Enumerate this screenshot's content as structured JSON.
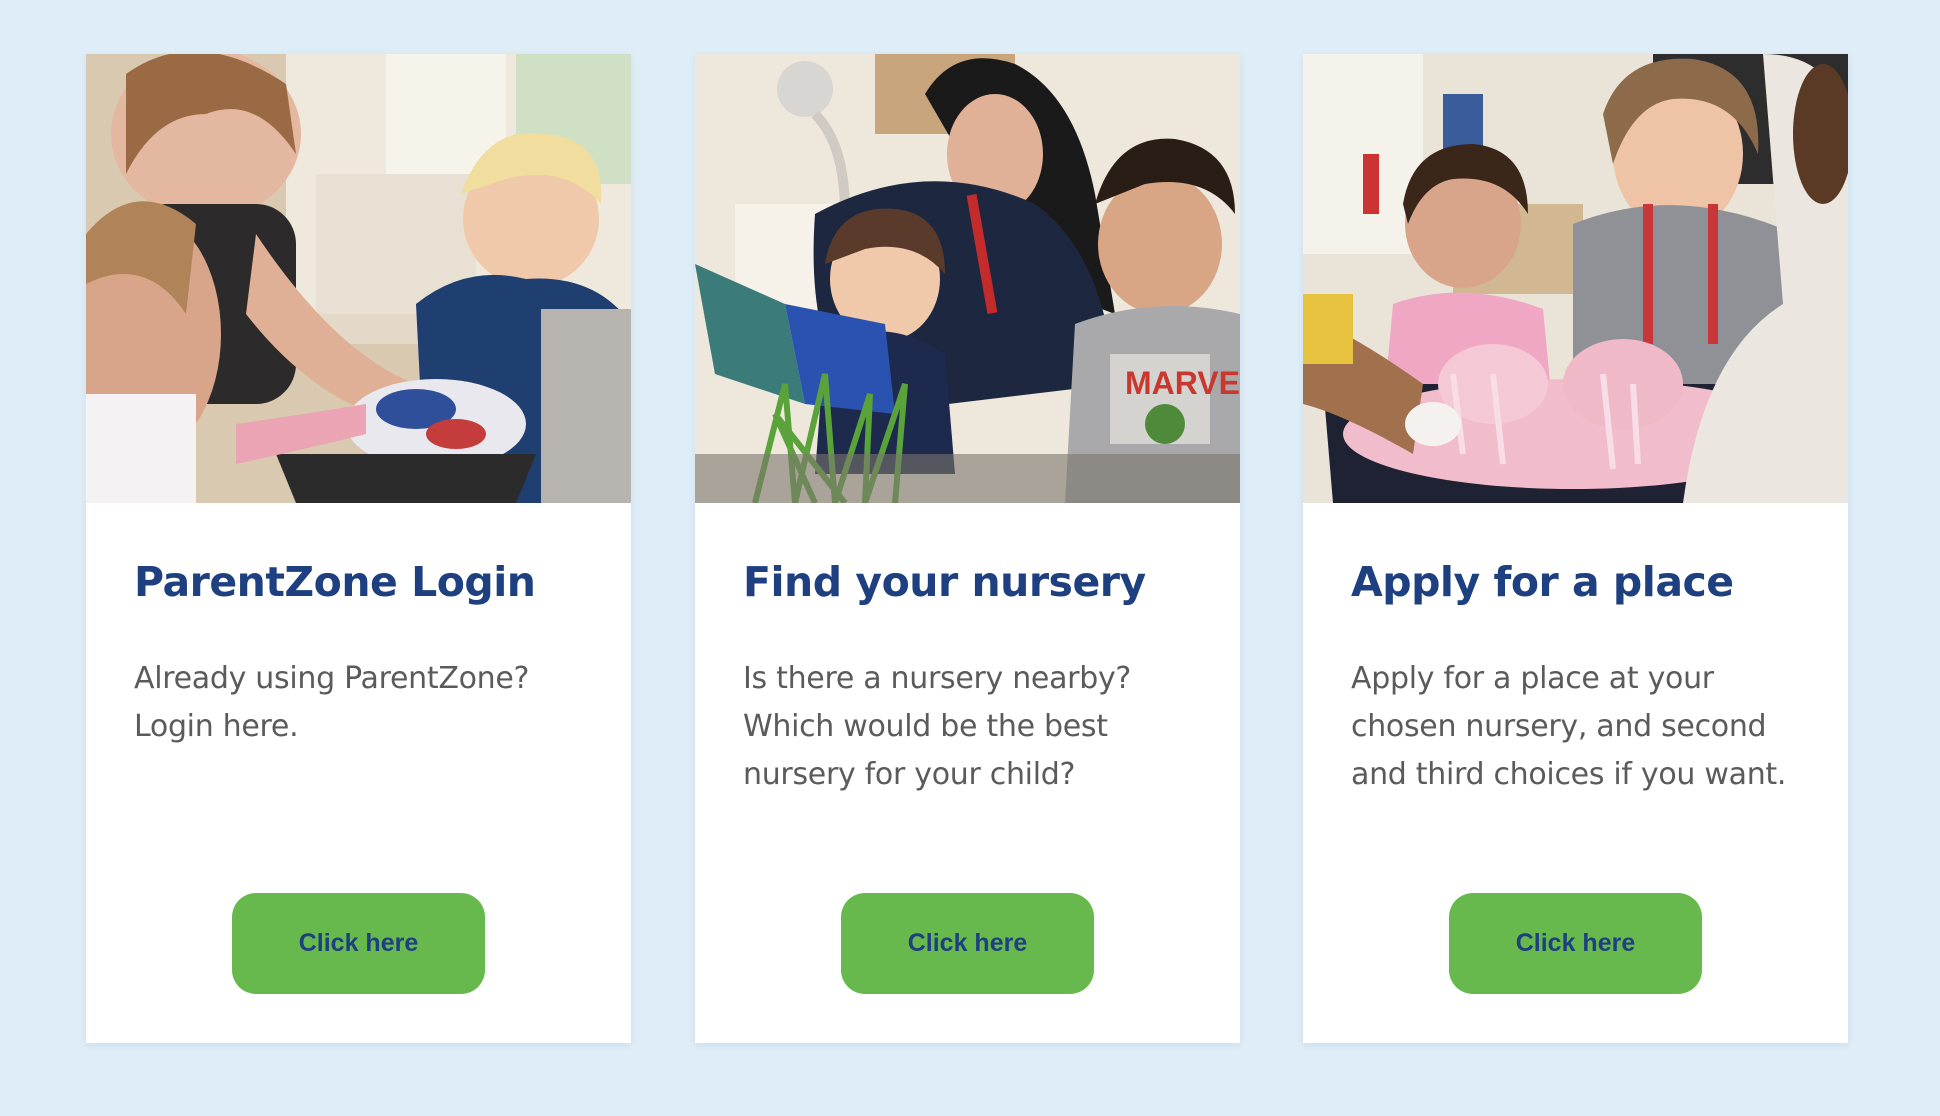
{
  "cards": [
    {
      "title": "ParentZone Login",
      "text": "Already using ParentZone? Login here.",
      "button_label": "Click here"
    },
    {
      "title": "Find your nursery",
      "text": "Is there a nursery nearby? Which would be the best nursery for your child?",
      "button_label": "Click here"
    },
    {
      "title": "Apply for a place",
      "text": "Apply for a place at your chosen nursery, and second and third choices if you want.",
      "button_label": "Click here"
    }
  ],
  "colors": {
    "page_background": "#deedf7",
    "card_background": "#ffffff",
    "title": "#1e3f80",
    "body_text": "#5b5b5b",
    "button_background": "#67b94d",
    "button_text": "#1e3f80"
  }
}
